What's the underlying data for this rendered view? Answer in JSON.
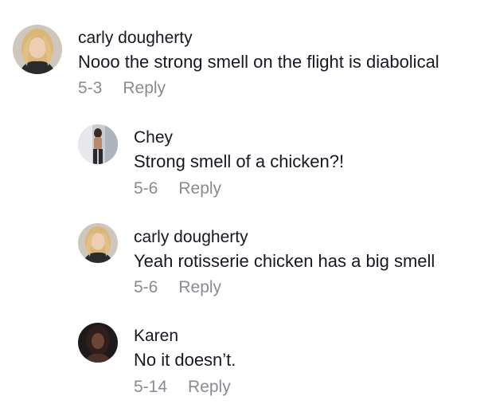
{
  "comments": [
    {
      "author": "carly dougherty",
      "text": "Nooo the strong smell on the flight is diabolical",
      "date": "5-3",
      "reply_label": "Reply",
      "avatar_icon": "profile-photo-blonde-woman"
    },
    {
      "author": "Chey",
      "text": "Strong smell of a chicken?!",
      "date": "5-6",
      "reply_label": "Reply",
      "avatar_icon": "profile-photo-mirror-selfie"
    },
    {
      "author": "carly dougherty",
      "text": "Yeah rotisserie chicken has a big smell",
      "date": "5-6",
      "reply_label": "Reply",
      "avatar_icon": "profile-photo-blonde-woman"
    },
    {
      "author": "Karen",
      "text": "No it doesn’t.",
      "date": "5-14",
      "reply_label": "Reply",
      "avatar_icon": "profile-photo-dark-portrait"
    }
  ],
  "colors": {
    "text": "#161823",
    "meta": "#8a8b91",
    "background": "#ffffff"
  }
}
